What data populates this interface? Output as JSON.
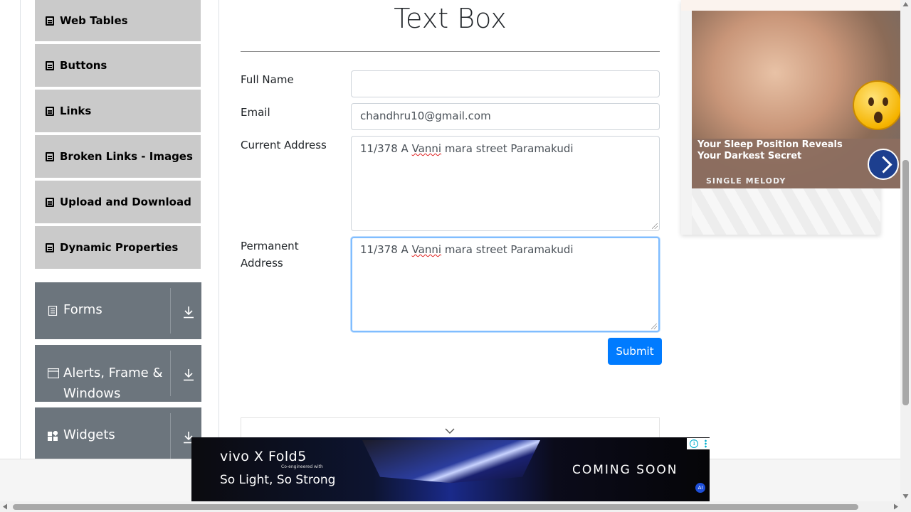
{
  "sidebar": {
    "elements_items": [
      {
        "label": "Web Tables"
      },
      {
        "label": "Buttons"
      },
      {
        "label": "Links"
      },
      {
        "label": "Broken Links - Images"
      },
      {
        "label": "Upload and Download"
      },
      {
        "label": "Dynamic Properties"
      }
    ],
    "groups": [
      {
        "label": "Forms",
        "icon": "form-icon"
      },
      {
        "label": "Alerts, Frame & Windows",
        "icon": "window-icon"
      },
      {
        "label": "Widgets",
        "icon": "widgets-icon"
      }
    ]
  },
  "form": {
    "title": "Text Box",
    "full_name_label": "Full Name",
    "full_name_value": "",
    "email_label": "Email",
    "email_value": "chandhru10@gmail.com",
    "current_address_label": "Current Address",
    "current_address_prefix": "11/378 A ",
    "current_address_misspelled": "Vanni",
    "current_address_suffix": " mara street Paramakudi",
    "permanent_address_label_line1": "Permanent",
    "permanent_address_label_line2": "Address",
    "permanent_address_prefix": "11/378 A ",
    "permanent_address_misspelled": "Vanni",
    "permanent_address_suffix": " mara street Paramakudi",
    "submit_label": "Submit"
  },
  "side_ad": {
    "headline": "Your Sleep Position Reveals Your Darkest Secret",
    "brand": "SINGLE MELODY"
  },
  "bottom_ad": {
    "brand": "vivo X Fold5",
    "co_engineered": "Co-engineered with",
    "slogan": "So Light, So Strong",
    "cta": "COMING SOON",
    "ai_badge": "AI"
  },
  "colors": {
    "primary_button": "#007bff",
    "sidebar_item_bg": "#cacaca",
    "sidebar_group_bg": "#6c757d",
    "focus_border": "#80bdff"
  }
}
